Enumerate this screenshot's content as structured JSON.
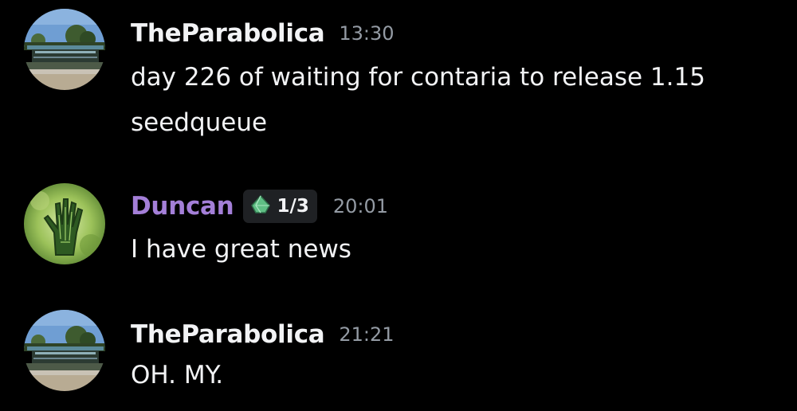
{
  "messages": [
    {
      "username": "TheParabolica",
      "username_color": "#f2f3f5",
      "timestamp": "13:30",
      "content": "day 226 of waiting for contaria to release 1.15 seedqueue",
      "avatar": "race-track-grandstand-avatar"
    },
    {
      "username": "Duncan",
      "username_color": "#a47fd8",
      "badge": {
        "icon": "gem-icon",
        "count": "1/3"
      },
      "timestamp": "20:01",
      "content": "I have great news",
      "avatar": "green-hand-avatar"
    },
    {
      "username": "TheParabolica",
      "username_color": "#f2f3f5",
      "timestamp": "21:21",
      "content": "OH. MY.",
      "avatar": "race-track-grandstand-avatar"
    }
  ]
}
